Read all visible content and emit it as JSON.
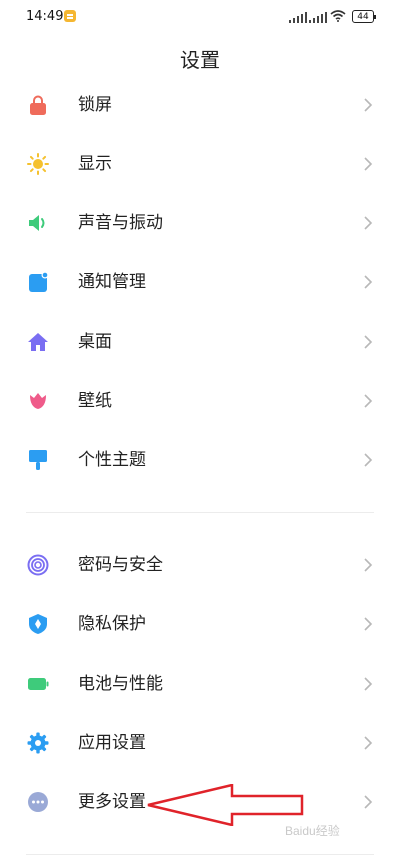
{
  "status_bar": {
    "time": "14:49",
    "battery": "44"
  },
  "title": "设置",
  "items": [
    {
      "label": "锁屏",
      "icon": "lock-icon",
      "color": "#ef6b5b"
    },
    {
      "label": "显示",
      "icon": "sun-icon",
      "color": "#f5c12e"
    },
    {
      "label": "声音与振动",
      "icon": "speaker-icon",
      "color": "#3ecb7b"
    },
    {
      "label": "通知管理",
      "icon": "notification-icon",
      "color": "#2b9df2"
    },
    {
      "label": "桌面",
      "icon": "home-icon",
      "color": "#7a6ef2"
    },
    {
      "label": "壁纸",
      "icon": "tulip-icon",
      "color": "#ef5b8a"
    },
    {
      "label": "个性主题",
      "icon": "paint-brush-icon",
      "color": "#2b9df2"
    },
    {
      "label": "密码与安全",
      "icon": "fingerprint-icon",
      "color": "#7a6ef2"
    },
    {
      "label": "隐私保护",
      "icon": "privacy-shield-icon",
      "color": "#2b9df2"
    },
    {
      "label": "电池与性能",
      "icon": "battery-icon",
      "color": "#3ecb7b"
    },
    {
      "label": "应用设置",
      "icon": "gear-icon",
      "color": "#2b9df2"
    },
    {
      "label": "更多设置",
      "icon": "more-icon",
      "color": "#9aa9d6"
    }
  ],
  "watermark": "Baidu经验"
}
